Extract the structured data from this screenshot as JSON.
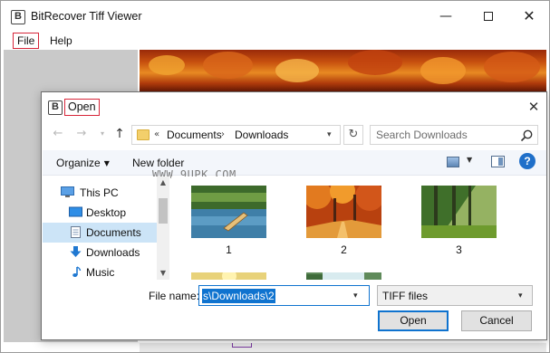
{
  "app": {
    "logo_letter": "B",
    "title": "BitRecover Tiff Viewer",
    "menu": {
      "file": "File",
      "help": "Help"
    },
    "window_controls": {
      "minimize_glyph": "—",
      "close_glyph": "✕"
    }
  },
  "dialog": {
    "logo_letter": "B",
    "title": "Open",
    "close_glyph": "✕",
    "nav": {
      "back_glyph": "←",
      "forward_glyph": "→",
      "recent_glyph": "▾",
      "up_glyph": "↑"
    },
    "address": {
      "overflow": "«",
      "crumbs": [
        "Documents",
        "Downloads"
      ],
      "separator": "›",
      "refresh_glyph": "↻"
    },
    "search": {
      "placeholder": "Search Downloads"
    },
    "toolbar": {
      "organize": "Organize",
      "new_folder": "New folder",
      "help_glyph": "?"
    },
    "watermark": "WWW.9UPK.COM",
    "nav_pane": {
      "items": [
        {
          "label": "This PC",
          "icon": "monitor-icon"
        },
        {
          "label": "Desktop",
          "icon": "desktop-icon"
        },
        {
          "label": "Documents",
          "icon": "documents-icon",
          "selected": true
        },
        {
          "label": "Downloads",
          "icon": "download-arrow-icon"
        },
        {
          "label": "Music",
          "icon": "music-note-icon"
        }
      ]
    },
    "files": [
      {
        "label": "1",
        "scene": "canoe-lake"
      },
      {
        "label": "2",
        "scene": "autumn-forest"
      },
      {
        "label": "3",
        "scene": "sunlit-forest"
      },
      {
        "label": "",
        "scene": "sunset-field"
      },
      {
        "label": "",
        "scene": "waterfall"
      }
    ],
    "file_name": {
      "label": "File name:",
      "value": "s\\Downloads\\2"
    },
    "file_type": {
      "value": "TIFF files"
    },
    "buttons": {
      "open": "Open",
      "cancel": "Cancel"
    },
    "colors": {
      "accent": "#0f73cf",
      "highlight_border": "#d7263a",
      "nav_selected": "#cce4f7"
    }
  }
}
